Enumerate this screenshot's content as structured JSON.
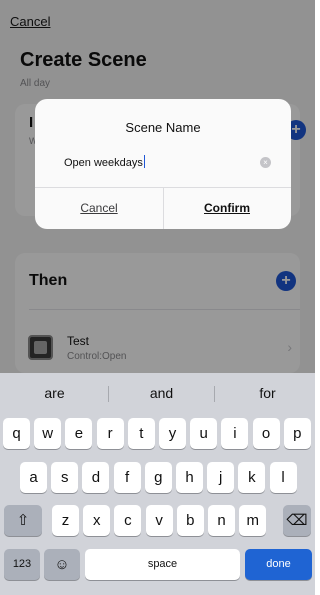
{
  "background": {
    "cancel": "Cancel",
    "title": "Create Scene",
    "subtitle": "All day",
    "if_initial": "I",
    "if_sub": "W",
    "then_label": "Then",
    "add_glyph": "+",
    "device": {
      "name": "Test",
      "status": "Control:Open",
      "icon": "device-thumbnail-icon",
      "chevron": "›"
    }
  },
  "dialog": {
    "title": "Scene Name",
    "input_value": "Open weekdays",
    "clear_glyph": "×",
    "cancel_label": "Cancel",
    "confirm_label": "Confirm"
  },
  "keyboard": {
    "suggestions": [
      "are",
      "and",
      "for"
    ],
    "row1": [
      "q",
      "w",
      "e",
      "r",
      "t",
      "y",
      "u",
      "i",
      "o",
      "p"
    ],
    "row2": [
      "a",
      "s",
      "d",
      "f",
      "g",
      "h",
      "j",
      "k",
      "l"
    ],
    "row3": [
      "z",
      "x",
      "c",
      "v",
      "b",
      "n",
      "m"
    ],
    "shift_glyph": "⇧",
    "delete_glyph": "⌫",
    "numbers_label": "123",
    "emoji_glyph": "☺",
    "space_label": "space",
    "done_label": "done"
  },
  "colors": {
    "accent": "#1f57d6",
    "done_key": "#1f64d3",
    "keyboard_bg": "#d1d3d9"
  }
}
